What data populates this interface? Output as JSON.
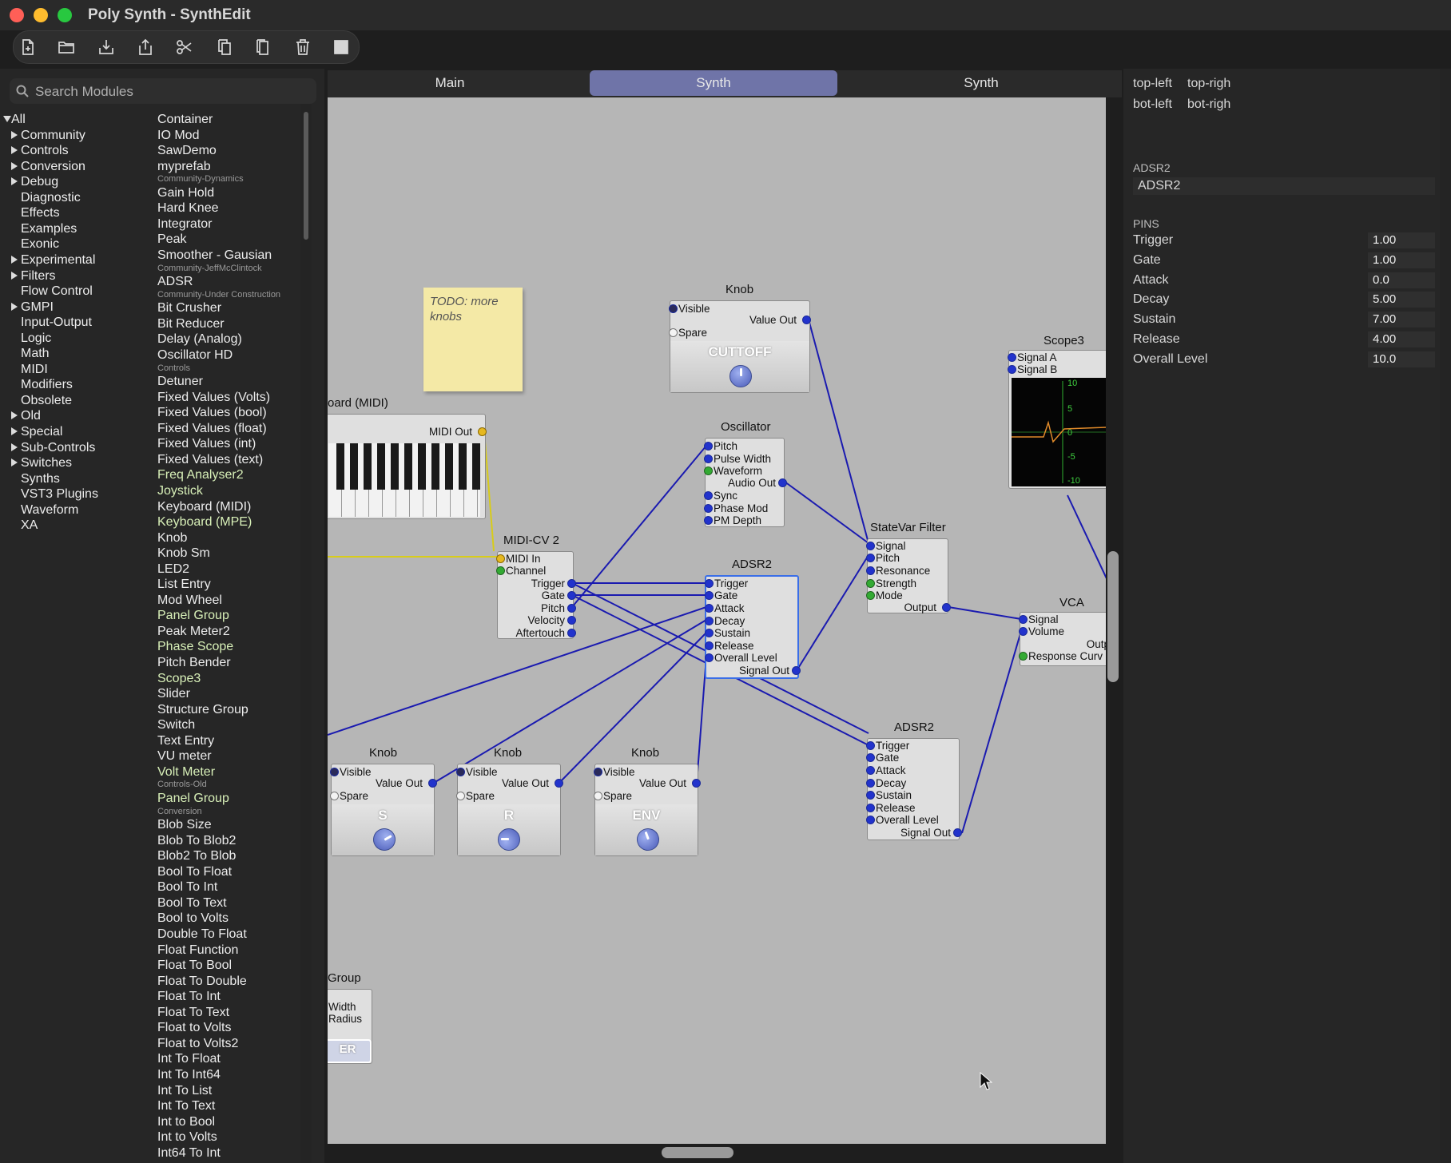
{
  "window": {
    "title": "Poly Synth - SynthEdit"
  },
  "toolbar": {
    "icons": [
      "new-file-icon",
      "open-folder-icon",
      "save-icon",
      "share-icon",
      "cut-icon",
      "copy-icon",
      "paste-icon",
      "trash-icon",
      "stop-icon"
    ]
  },
  "search": {
    "placeholder": "Search Modules"
  },
  "categories": [
    "All",
    "Community",
    "Controls",
    "Conversion",
    "Debug",
    "Diagnostic",
    "Effects",
    "Examples",
    "Exonic",
    "Experimental",
    "Filters",
    "Flow Control",
    "GMPI",
    "Input-Output",
    "Logic",
    "Math",
    "MIDI",
    "Modifiers",
    "Obsolete",
    "Old",
    "Special",
    "Sub-Controls",
    "Switches",
    "Synths",
    "VST3 Plugins",
    "Waveform",
    "XA"
  ],
  "modules": [
    {
      "t": "Container"
    },
    {
      "t": "IO Mod"
    },
    {
      "t": "SawDemo"
    },
    {
      "t": "myprefab"
    },
    {
      "t": "Community-Dynamics",
      "s": 1
    },
    {
      "t": "Gain Hold"
    },
    {
      "t": "Hard Knee"
    },
    {
      "t": "Integrator"
    },
    {
      "t": "Peak"
    },
    {
      "t": "Smoother - Gausian"
    },
    {
      "t": "Community-JeffMcClintock",
      "s": 1
    },
    {
      "t": "ADSR"
    },
    {
      "t": "Community-Under Construction",
      "s": 1
    },
    {
      "t": "Bit Crusher"
    },
    {
      "t": "Bit Reducer"
    },
    {
      "t": "Delay (Analog)"
    },
    {
      "t": "Oscillator HD"
    },
    {
      "t": "Controls",
      "s": 1
    },
    {
      "t": "Detuner"
    },
    {
      "t": "Fixed Values (Volts)"
    },
    {
      "t": "Fixed Values (bool)"
    },
    {
      "t": "Fixed Values (float)"
    },
    {
      "t": "Fixed Values (int)"
    },
    {
      "t": "Fixed Values (text)"
    },
    {
      "t": "Freq Analyser2",
      "g": 1
    },
    {
      "t": "Joystick",
      "g": 1
    },
    {
      "t": "Keyboard (MIDI)"
    },
    {
      "t": "Keyboard (MPE)",
      "g": 1
    },
    {
      "t": "Knob"
    },
    {
      "t": "Knob Sm"
    },
    {
      "t": "LED2"
    },
    {
      "t": "List Entry"
    },
    {
      "t": "Mod Wheel"
    },
    {
      "t": "Panel Group",
      "g": 1
    },
    {
      "t": "Peak Meter2"
    },
    {
      "t": "Phase Scope",
      "g": 1
    },
    {
      "t": "Pitch Bender"
    },
    {
      "t": "Scope3",
      "g": 1
    },
    {
      "t": "Slider"
    },
    {
      "t": "Structure Group"
    },
    {
      "t": "Switch"
    },
    {
      "t": "Text Entry"
    },
    {
      "t": "VU meter"
    },
    {
      "t": "Volt Meter",
      "g": 1
    },
    {
      "t": "Controls-Old",
      "s": 1
    },
    {
      "t": "Panel Group",
      "g": 1
    },
    {
      "t": "Conversion",
      "s": 1
    },
    {
      "t": "Blob Size"
    },
    {
      "t": "Blob To Blob2"
    },
    {
      "t": "Blob2 To Blob"
    },
    {
      "t": "Bool To Float"
    },
    {
      "t": "Bool To Int"
    },
    {
      "t": "Bool To Text"
    },
    {
      "t": "Bool to Volts"
    },
    {
      "t": "Double To Float"
    },
    {
      "t": "Float Function"
    },
    {
      "t": "Float To Bool"
    },
    {
      "t": "Float To Double"
    },
    {
      "t": "Float To Int"
    },
    {
      "t": "Float To Text"
    },
    {
      "t": "Float to Volts"
    },
    {
      "t": "Float to Volts2"
    },
    {
      "t": "Int To Float"
    },
    {
      "t": "Int To Int64"
    },
    {
      "t": "Int To List"
    },
    {
      "t": "Int To Text"
    },
    {
      "t": "Int to Bool"
    },
    {
      "t": "Int to Volts"
    },
    {
      "t": "Int64 To Int"
    }
  ],
  "tabs": [
    "Main",
    "Synth",
    "Synth"
  ],
  "canvas": {
    "note": "TODO: more knobs",
    "keyboard": {
      "title": "oard (MIDI)",
      "pin": "MIDI Out"
    },
    "knob_cutoff": {
      "title": "Knob",
      "pins": [
        "Visible",
        "Value Out",
        "Spare"
      ],
      "label": "CUTTOFF"
    },
    "oscillator": {
      "title": "Oscillator",
      "pins": [
        "Pitch",
        "Pulse Width",
        "Waveform",
        "Audio Out",
        "Sync",
        "Phase Mod",
        "PM Depth"
      ]
    },
    "midicv": {
      "title": "MIDI-CV 2",
      "pins": [
        "MIDI In",
        "Channel",
        "Trigger",
        "Gate",
        "Pitch",
        "Velocity",
        "Aftertouch"
      ]
    },
    "adsr_main": {
      "title": "ADSR2",
      "pins": [
        "Trigger",
        "Gate",
        "Attack",
        "Decay",
        "Sustain",
        "Release",
        "Overall Level",
        "Signal Out"
      ]
    },
    "statevar": {
      "title": "StateVar Filter",
      "pins": [
        "Signal",
        "Pitch",
        "Resonance",
        "Strength",
        "Mode",
        "Output"
      ]
    },
    "scope": {
      "title": "Scope3",
      "pins": [
        "Signal A",
        "Signal B"
      ],
      "ticks": [
        "10",
        "5",
        "0",
        "-5",
        "-10"
      ]
    },
    "vca": {
      "title": "VCA",
      "pins": [
        "Signal",
        "Volume",
        "Outp",
        "Response Curv"
      ]
    },
    "adsr_2": {
      "title": "ADSR2",
      "pins": [
        "Trigger",
        "Gate",
        "Attack",
        "Decay",
        "Sustain",
        "Release",
        "Overall Level",
        "Signal Out"
      ]
    },
    "knob_s": {
      "title": "Knob",
      "pins": [
        "Visible",
        "Value Out",
        "Spare"
      ],
      "label": "S"
    },
    "knob_r": {
      "title": "Knob",
      "pins": [
        "Visible",
        "Value Out",
        "Spare"
      ],
      "label": "R"
    },
    "knob_env": {
      "title": "Knob",
      "pins": [
        "Visible",
        "Value Out",
        "Spare"
      ],
      "label": "ENV"
    },
    "group": {
      "title": "Group",
      "pins": [
        "Width",
        "Radius"
      ],
      "label": "ER"
    }
  },
  "right": {
    "corners": [
      "top-left",
      "top-righ",
      "bot-left",
      "bot-righ"
    ],
    "module_header": "ADSR2",
    "module_name": "ADSR2",
    "pins_header": "PINS",
    "pins": [
      {
        "name": "Trigger",
        "value": "1.00"
      },
      {
        "name": "Gate",
        "value": "1.00"
      },
      {
        "name": "Attack",
        "value": "0.0"
      },
      {
        "name": "Decay",
        "value": "5.00"
      },
      {
        "name": "Sustain",
        "value": "7.00"
      },
      {
        "name": "Release",
        "value": "4.00"
      },
      {
        "name": "Overall Level",
        "value": "10.0"
      }
    ]
  },
  "colors": {
    "selection_tab": "#6f74a8",
    "wire": "#1a1ab0",
    "midi_wire": "#e0d020",
    "canvas": "#b6b6b6"
  }
}
